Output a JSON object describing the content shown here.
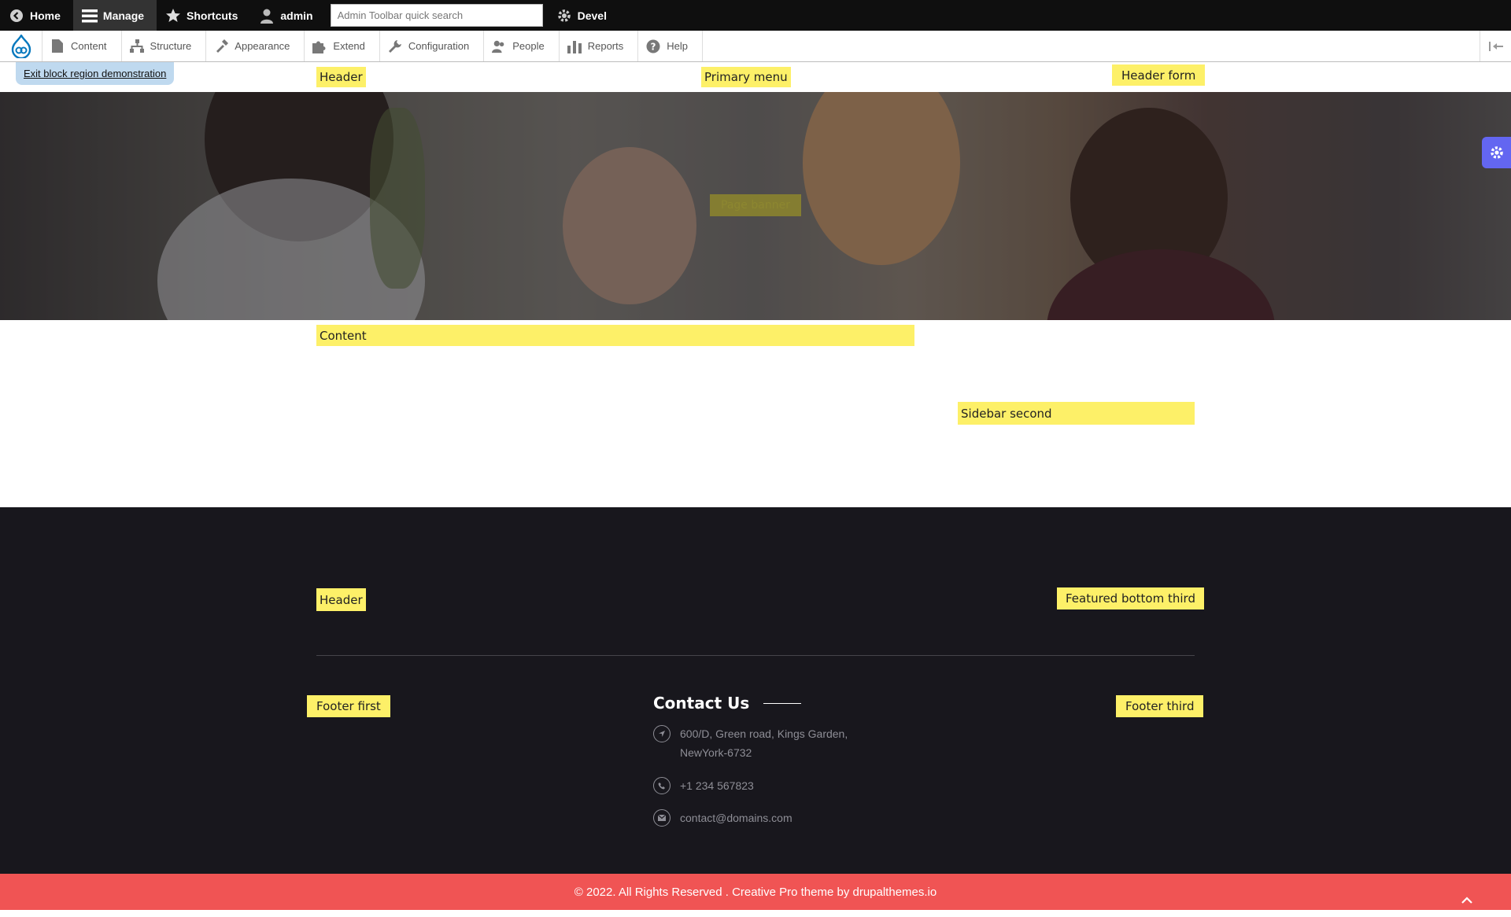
{
  "toolbar": {
    "home": "Home",
    "manage": "Manage",
    "shortcuts": "Shortcuts",
    "user": "admin",
    "search_placeholder": "Admin Toolbar quick search",
    "devel": "Devel"
  },
  "tray": {
    "items": [
      "Content",
      "Structure",
      "Appearance",
      "Extend",
      "Configuration",
      "People",
      "Reports",
      "Help"
    ]
  },
  "header": {
    "exit_demo": "Exit block region demonstration",
    "regions": {
      "header": "Header",
      "primary_menu": "Primary menu",
      "header_form": "Header form"
    }
  },
  "hero": {
    "banner_label": "Page banner"
  },
  "main": {
    "content": "Content",
    "sidebar_second": "Sidebar second"
  },
  "footer": {
    "header_region": "Header",
    "featured_bottom_third": "Featured bottom third",
    "footer_first": "Footer first",
    "footer_third": "Footer third",
    "contact": {
      "title": "Contact Us",
      "address_line1": "600/D, Green road, Kings Garden,",
      "address_line2": "NewYork-6732",
      "phone": "+1 234 567823",
      "email": "contact@domains.com"
    },
    "copyright": "© 2022. All Rights Reserved . Creative Pro theme by drupalthemes.io"
  },
  "colors": {
    "toolbar_bg": "#0f0f0f",
    "region_highlight": "#fdf068",
    "footer_bg": "#18171d",
    "copyright_bg": "#f05454",
    "settings_tab": "#6366f1",
    "drupal_blue": "#0678be"
  },
  "icons": [
    "home-icon",
    "menu-icon",
    "star-icon",
    "user-icon",
    "gear-icon",
    "drupal-logo-icon",
    "file-icon",
    "sitemap-icon",
    "brush-icon",
    "puzzle-icon",
    "wrench-icon",
    "people-icon",
    "bar-chart-icon",
    "help-icon",
    "collapse-icon",
    "location-icon",
    "phone-icon",
    "mail-icon",
    "chevron-up-icon"
  ]
}
